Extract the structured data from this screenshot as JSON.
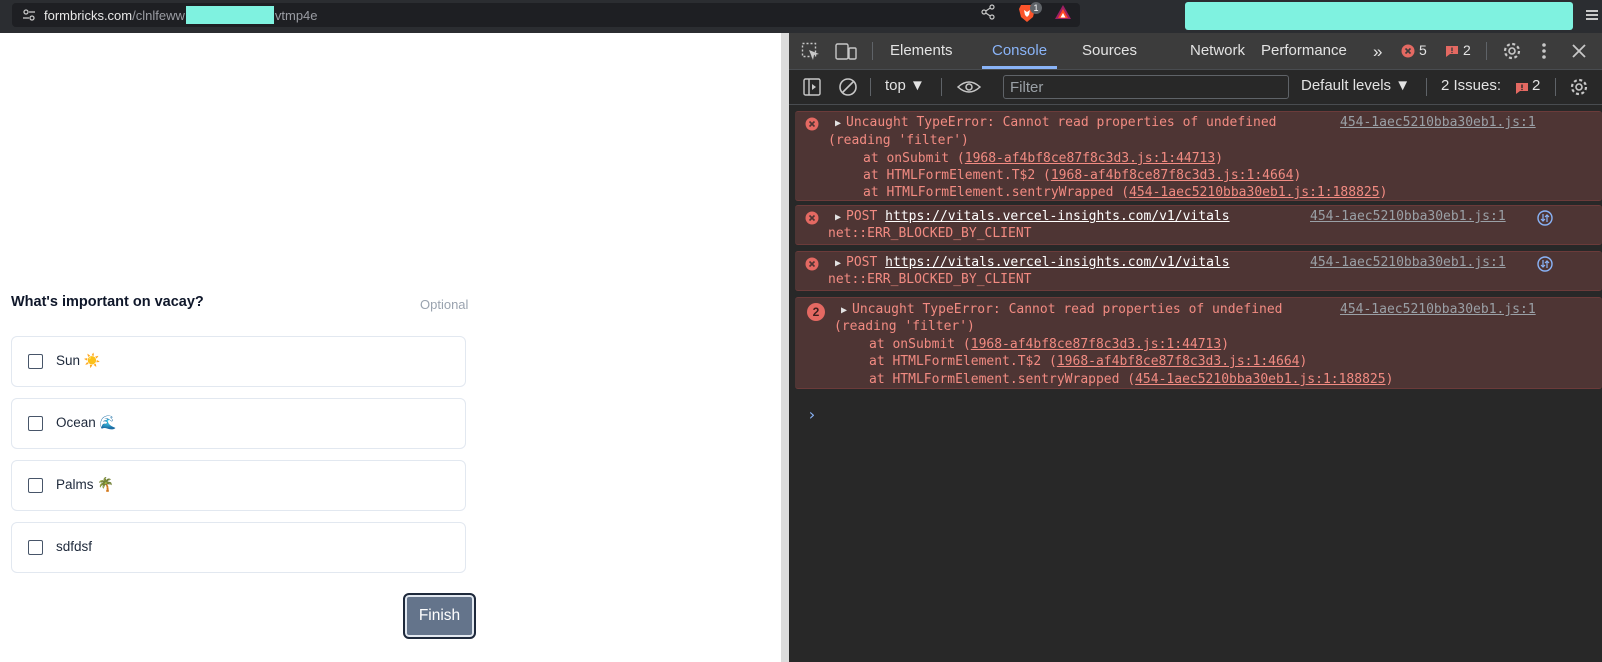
{
  "browser": {
    "url_domain": "formbricks.com",
    "url_path_start": "/clnlfeww",
    "url_path_end": "vtmp4e",
    "brave_badge": "1"
  },
  "survey": {
    "question": "What's important on vacay?",
    "optional_label": "Optional",
    "options": [
      {
        "label": "Sun ☀️"
      },
      {
        "label": "Ocean 🌊"
      },
      {
        "label": "Palms 🌴"
      },
      {
        "label": "sdfdsf"
      }
    ],
    "finish_label": "Finish"
  },
  "devtools": {
    "tabs": [
      "Elements",
      "Console",
      "Sources",
      "Network",
      "Performance"
    ],
    "active_tab": "Console",
    "error_count": "5",
    "warning_count": "2",
    "context": "top",
    "filter_placeholder": "Filter",
    "levels": "Default levels",
    "issues_label": "2 Issues:",
    "issues_count": "2",
    "messages": [
      {
        "text": "Uncaught TypeError: Cannot read properties of undefined",
        "text2": "(reading 'filter')",
        "source": "454-1aec5210bba30eb1.js:1",
        "stack": [
          {
            "prefix": "at onSubmit (",
            "link": "1968-af4bf8ce87f8c3d3.js:1:44713",
            "suffix": ")"
          },
          {
            "prefix": "at HTMLFormElement.T$2 (",
            "link": "1968-af4bf8ce87f8c3d3.js:1:4664",
            "suffix": ")"
          },
          {
            "prefix": "at HTMLFormElement.sentryWrapped (",
            "link": "454-1aec5210bba30eb1.js:1:188825",
            "suffix": ")"
          }
        ]
      },
      {
        "method": "POST",
        "url": "https://vitals.vercel-insights.com/v1/vitals",
        "error": "net::ERR_BLOCKED_BY_CLIENT",
        "source": "454-1aec5210bba30eb1.js:1"
      },
      {
        "method": "POST",
        "url": "https://vitals.vercel-insights.com/v1/vitals",
        "error": "net::ERR_BLOCKED_BY_CLIENT",
        "source": "454-1aec5210bba30eb1.js:1"
      },
      {
        "repeat": "2",
        "text": "Uncaught TypeError: Cannot read properties of undefined",
        "text2": "(reading 'filter')",
        "source": "454-1aec5210bba30eb1.js:1",
        "stack": [
          {
            "prefix": "at onSubmit (",
            "link": "1968-af4bf8ce87f8c3d3.js:1:44713",
            "suffix": ")"
          },
          {
            "prefix": "at HTMLFormElement.T$2 (",
            "link": "1968-af4bf8ce87f8c3d3.js:1:4664",
            "suffix": ")"
          },
          {
            "prefix": "at HTMLFormElement.sentryWrapped (",
            "link": "454-1aec5210bba30eb1.js:1:188825",
            "suffix": ")"
          }
        ]
      }
    ],
    "prompt": "›"
  }
}
